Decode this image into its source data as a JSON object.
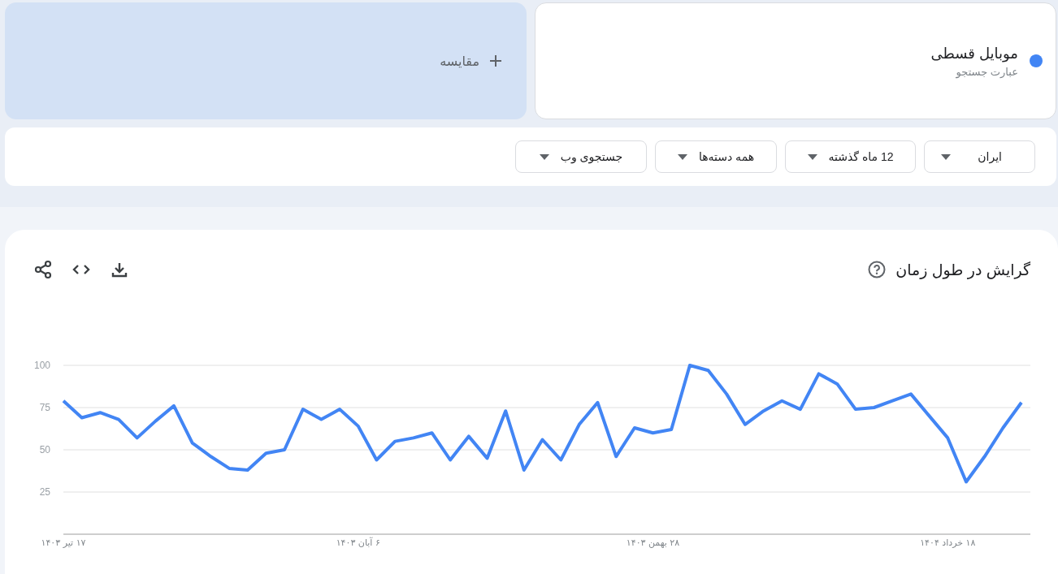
{
  "term": {
    "name": "موبایل قسطی",
    "subtitle": "عبارت جستجو",
    "color": "#4285f4"
  },
  "compare": {
    "label": "مقایسه"
  },
  "filters": [
    {
      "label": "ایران"
    },
    {
      "label": "12 ماه گذشته"
    },
    {
      "label": "همه دسته‌ها"
    },
    {
      "label": "جستجوی وب"
    }
  ],
  "chart_data": {
    "type": "line",
    "title": "گرایش در طول زمان",
    "grid": true,
    "categories": [
      "۱۷ تیر ۱۴۰۳",
      null,
      null,
      null,
      null,
      null,
      null,
      null,
      null,
      null,
      null,
      null,
      null,
      null,
      null,
      null,
      "۶ آبان ۱۴۰۳",
      null,
      null,
      null,
      null,
      null,
      null,
      null,
      null,
      null,
      null,
      null,
      null,
      null,
      null,
      null,
      "۲۸ بهمن ۱۴۰۳",
      null,
      null,
      null,
      null,
      null,
      null,
      null,
      null,
      null,
      null,
      null,
      null,
      null,
      null,
      null,
      "۱۸ خرداد ۱۴۰۴",
      null,
      null,
      null,
      null
    ],
    "series": [
      {
        "color": "#4285f4",
        "values": [
          79,
          69,
          72,
          68,
          57,
          67,
          76,
          54,
          46,
          39,
          38,
          48,
          50,
          74,
          68,
          74,
          64,
          44,
          55,
          57,
          60,
          44,
          58,
          45,
          73,
          38,
          56,
          44,
          65,
          78,
          46,
          63,
          60,
          62,
          100,
          97,
          83,
          65,
          73,
          79,
          74,
          95,
          89,
          74,
          75,
          79,
          83,
          70,
          57,
          31,
          46,
          63,
          78
        ]
      }
    ],
    "ylim": [
      0,
      100
    ],
    "yticks": [
      25,
      50,
      75,
      100
    ]
  }
}
